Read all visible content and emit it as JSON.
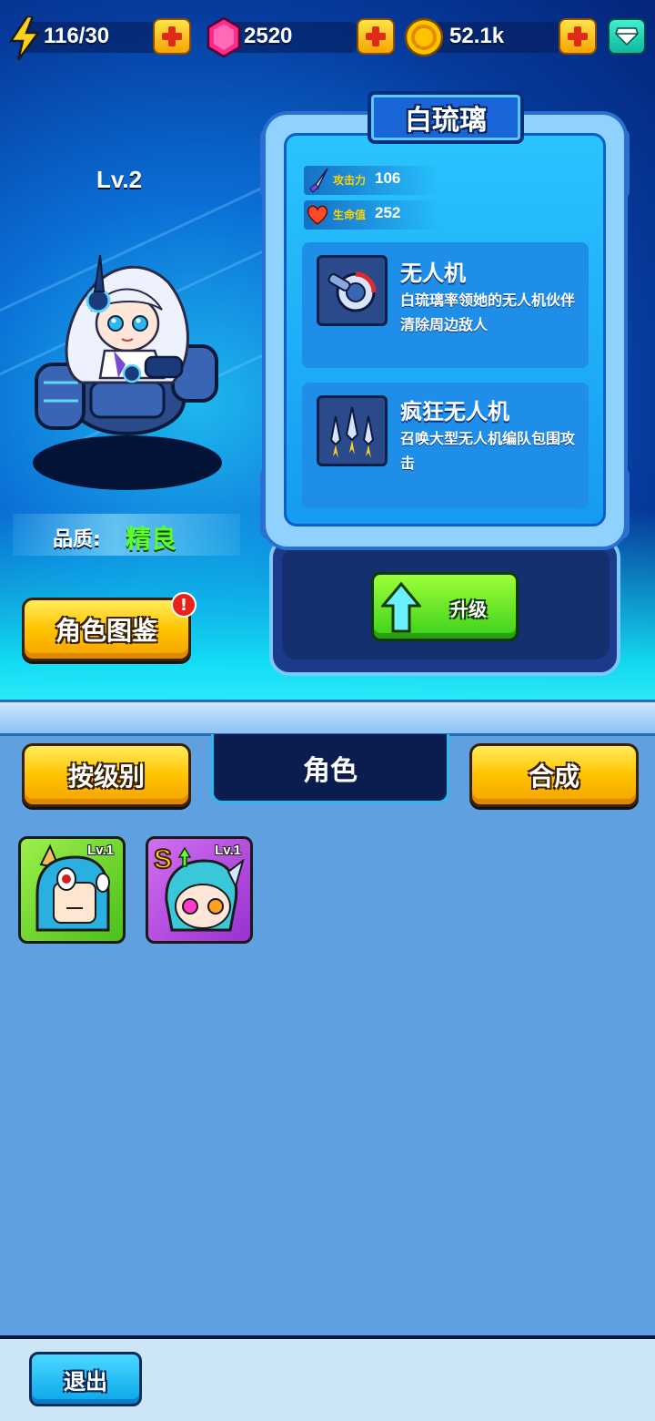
{
  "resources": {
    "energy": "116/30",
    "gems": "2520",
    "coins": "52.1k"
  },
  "character": {
    "level": "Lv.2",
    "quality_label": "品质:",
    "quality_value": "精良",
    "name": "白琉璃"
  },
  "stats": {
    "attack_label": "攻击力",
    "attack_value": "106",
    "hp_label": "生命值",
    "hp_value": "252"
  },
  "skills": [
    {
      "name": "无人机",
      "desc": "白琉璃率领她的无人机伙伴清除周边敌人"
    },
    {
      "name": "疯狂无人机",
      "desc": "召唤大型无人机编队包围攻击"
    }
  ],
  "buttons": {
    "codex": "角色图鉴",
    "codex_badge": "!",
    "upgrade": "升级",
    "sort_by_level": "按级别",
    "synthesize": "合成",
    "exit": "退出"
  },
  "tabs": {
    "active": "角色"
  },
  "roster": [
    {
      "level": "Lv.1",
      "color": "#5ccf2a"
    },
    {
      "level": "Lv.1",
      "color": "#b23ee0"
    }
  ],
  "colors": {
    "accent_yellow": "#ffc400",
    "quality_green": "#5cff2e",
    "panel_blue": "#159bf0"
  }
}
